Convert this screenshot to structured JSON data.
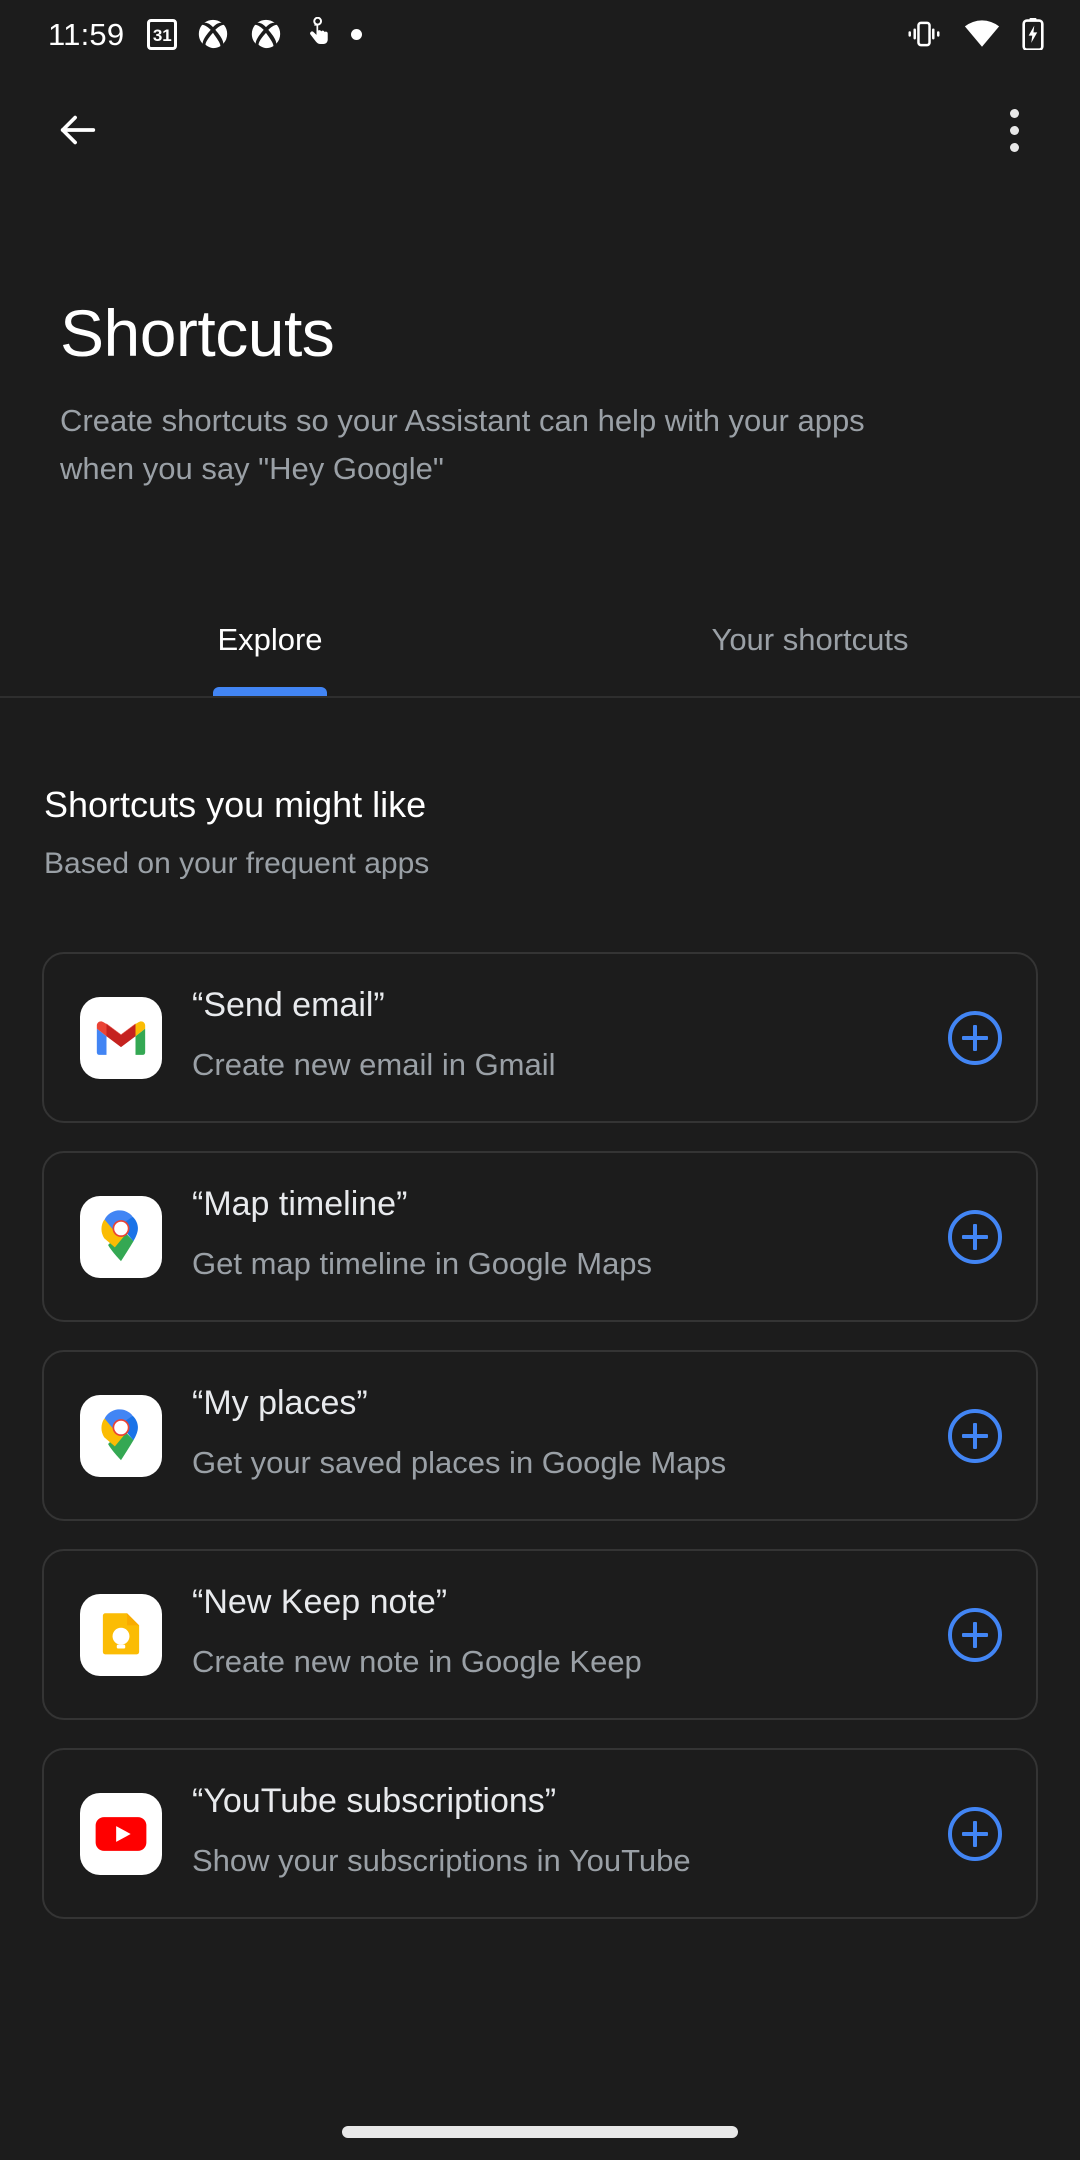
{
  "status_bar": {
    "time": "11:59",
    "left_icons": [
      {
        "name": "calendar-icon",
        "label": "31"
      },
      {
        "name": "xbox-icon",
        "label": ""
      },
      {
        "name": "xbox-icon",
        "label": ""
      },
      {
        "name": "touch-gesture-icon",
        "label": ""
      },
      {
        "name": "notification-dot-icon",
        "label": ""
      }
    ],
    "right_icons": [
      {
        "name": "vibrate-icon"
      },
      {
        "name": "wifi-icon"
      },
      {
        "name": "battery-charging-icon"
      }
    ]
  },
  "appbar": {
    "back_icon": "arrow-back-icon",
    "overflow_icon": "more-vertical-icon"
  },
  "header": {
    "title": "Shortcuts",
    "description": "Create shortcuts so your Assistant can help with your apps when you say \"Hey Google\""
  },
  "tabs": {
    "items": [
      {
        "label": "Explore",
        "selected": true
      },
      {
        "label": "Your shortcuts",
        "selected": false
      }
    ],
    "indicator_color": "#4285f4"
  },
  "section": {
    "title": "Shortcuts you might like",
    "subtitle": "Based on your frequent apps"
  },
  "cards": [
    {
      "icon": "gmail-icon",
      "title": "“Send email”",
      "subtitle": "Create new email in Gmail",
      "add_label": "add-icon"
    },
    {
      "icon": "google-maps-icon",
      "title": "“Map timeline”",
      "subtitle": "Get map timeline in Google Maps",
      "add_label": "add-icon"
    },
    {
      "icon": "google-maps-icon",
      "title": "“My places”",
      "subtitle": "Get your saved places in Google Maps",
      "add_label": "add-icon"
    },
    {
      "icon": "google-keep-icon",
      "title": "“New Keep note”",
      "subtitle": "Create new note in Google Keep",
      "add_label": "add-icon"
    },
    {
      "icon": "youtube-icon",
      "title": "“YouTube subscriptions”",
      "subtitle": "Show your subscriptions in YouTube",
      "add_label": "add-icon"
    }
  ],
  "colors": {
    "background": "#1c1c1c",
    "accent": "#4285f4",
    "primary_text": "#ffffff",
    "secondary_text": "#9aa0a6",
    "card_border": "#343434"
  },
  "nav_bar": {
    "gesture_pill": "home-gesture-pill"
  }
}
